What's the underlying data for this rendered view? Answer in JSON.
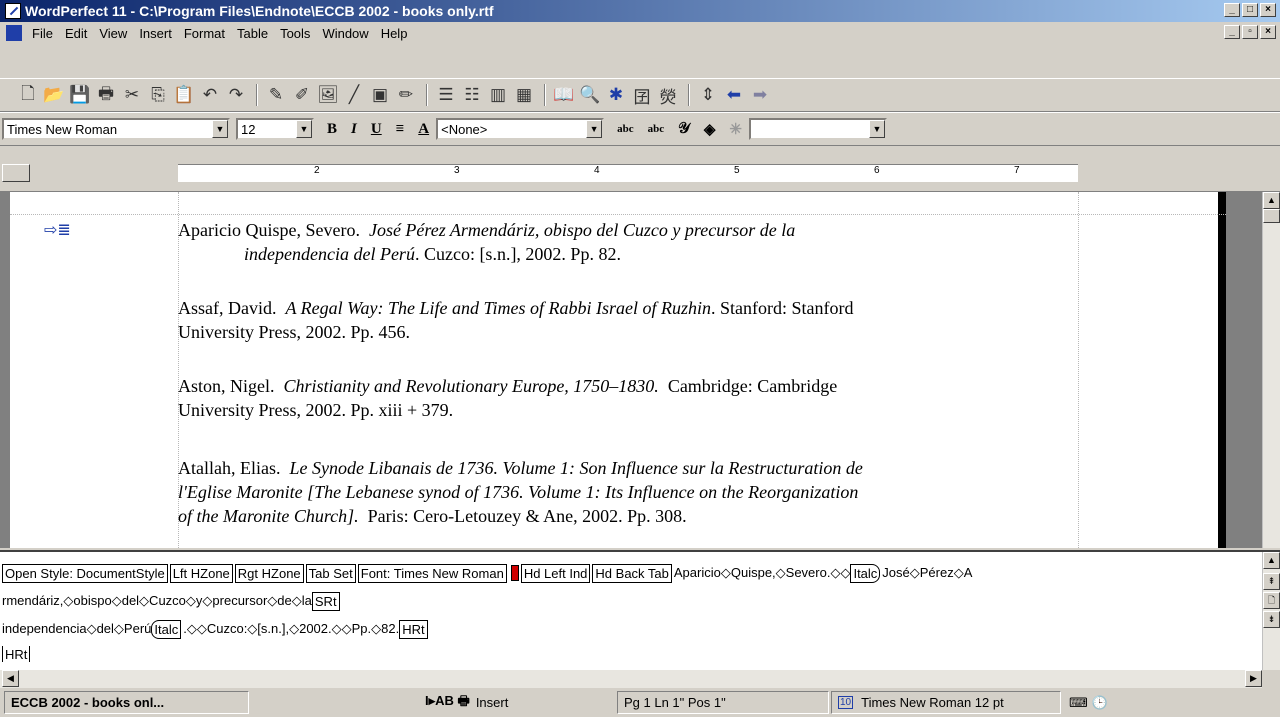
{
  "window": {
    "title": "WordPerfect 11 - C:\\Program Files\\Endnote\\ECCB 2002 - books only.rtf"
  },
  "menu": [
    "File",
    "Edit",
    "View",
    "Insert",
    "Format",
    "Table",
    "Tools",
    "Window",
    "Help"
  ],
  "fontbar": {
    "font": "Times New Roman",
    "size": "12",
    "style": "<None>"
  },
  "ruler": {
    "numbers": [
      "2",
      "3",
      "4",
      "5",
      "6",
      "7"
    ]
  },
  "document": {
    "entries": [
      {
        "author": "Aparicio Quispe, Severo.",
        "title_italic": "José Pérez Armendáriz, obispo del Cuzco y precursor de la",
        "title_italic_2": "independencia del Perú",
        "rest": ". Cuzco: [s.n.], 2002. Pp. 82."
      },
      {
        "author": "Assaf, David.",
        "title_italic": "A Regal Way: The Life and Times of Rabbi Israel of Ruzhin",
        "rest": ". Stanford: Stanford",
        "rest2": "University Press, 2002. Pp. 456."
      },
      {
        "author": "Aston, Nigel.",
        "title_italic": "Christianity and Revolutionary Europe, 1750–1830.",
        "rest": "Cambridge: Cambridge",
        "rest2": "University Press, 2002. Pp. xiii + 379."
      },
      {
        "author": "Atallah, Elias.",
        "title_italic": "Le Synode Libanais de 1736. Volume 1: Son Influence sur la Restructuration de",
        "title_italic_2": "l'Eglise Maronite [The Lebanese synod of 1736. Volume 1: Its Influence on the Reorganization",
        "title_italic_3": "of the Maronite Church].",
        "rest": "Paris: Cero-Letouzey & Ane, 2002. Pp. 308."
      }
    ]
  },
  "reveal_codes": {
    "line1_codes": [
      "Open Style: DocumentStyle",
      "Lft HZone",
      "Rgt HZone",
      "Tab Set",
      "Font: Times New Roman"
    ],
    "line1_codes2": [
      "Hd Left Ind",
      "Hd Back Tab"
    ],
    "line1_text": "Aparicio◇Quispe,◇Severo.◇◇",
    "line1_italc": "Italc",
    "line1_text2": "José◇Pérez◇A",
    "line2_text": "rmendáriz,◇obispo◇del◇Cuzco◇y◇precursor◇de◇la",
    "line2_code": "SRt",
    "line3_text": "independencia◇del◇Perú",
    "line3_italc": "Italc",
    "line3_text2": ".◇◇Cuzco:◇[s.n.],◇2002.◇◇Pp.◇82.",
    "line3_code": "HRt",
    "line4_code": "HRt"
  },
  "status": {
    "doc": "ECCB 2002 - books onl...",
    "mode": "Insert",
    "position": "Pg 1 Ln 1\" Pos 1\"",
    "font": "Times New Roman 12 pt"
  }
}
